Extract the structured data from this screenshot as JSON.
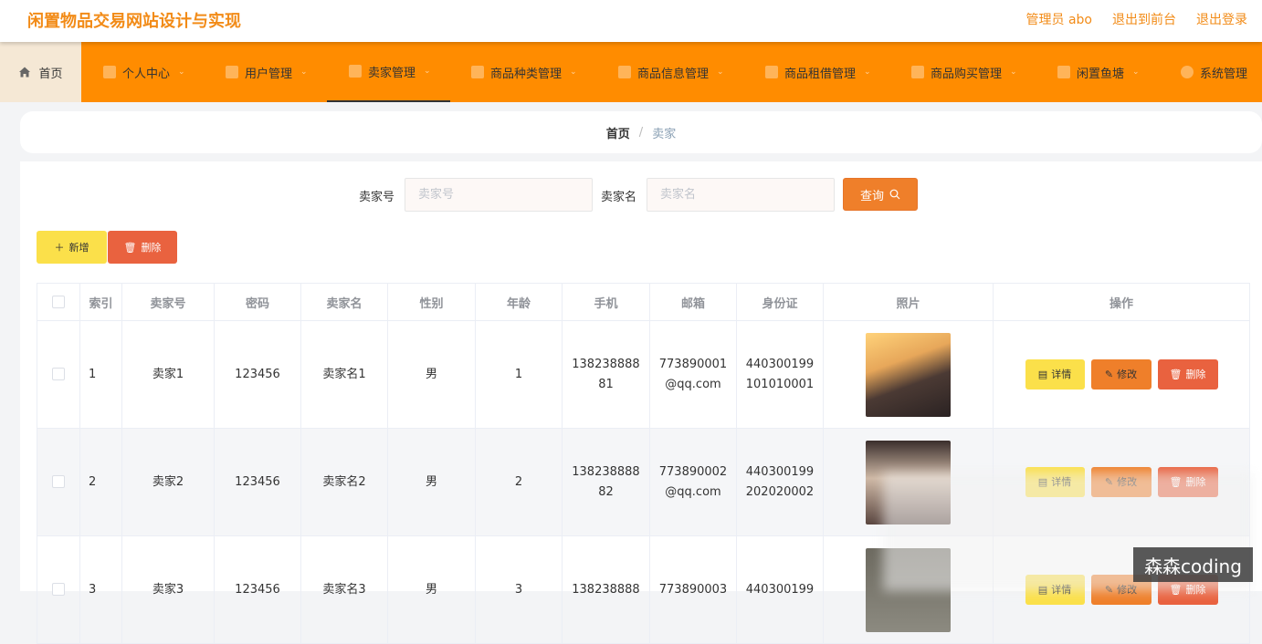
{
  "header": {
    "site_title": "闲置物品交易网站设计与实现",
    "admin_label": "管理员 abo",
    "front_link": "退出到前台",
    "logout_link": "退出登录"
  },
  "nav": {
    "home": "首页",
    "items": [
      {
        "label": "个人中心",
        "icon": "user-icon"
      },
      {
        "label": "用户管理",
        "icon": "list-icon"
      },
      {
        "label": "卖家管理",
        "icon": "menu-icon"
      },
      {
        "label": "商品种类管理",
        "icon": "user-icon"
      },
      {
        "label": "商品信息管理",
        "icon": "monitor-icon"
      },
      {
        "label": "商品租借管理",
        "icon": "clipboard-icon"
      },
      {
        "label": "商品购买管理",
        "icon": "copy-icon"
      },
      {
        "label": "闲置鱼塘",
        "icon": "message-icon"
      },
      {
        "label": "系统管理",
        "icon": "gear-icon"
      }
    ]
  },
  "breadcrumb": {
    "home": "首页",
    "separator": "/",
    "current": "卖家"
  },
  "search": {
    "field1_label": "卖家号",
    "field1_placeholder": "卖家号",
    "field2_label": "卖家名",
    "field2_placeholder": "卖家名",
    "query_label": "查询"
  },
  "actions": {
    "add_label": "新增",
    "delete_label": "删除"
  },
  "table": {
    "headers": [
      "索引",
      "卖家号",
      "密码",
      "卖家名",
      "性别",
      "年龄",
      "手机",
      "邮箱",
      "身份证",
      "照片",
      "操作"
    ],
    "rows": [
      {
        "index": "1",
        "seller_no": "卖家1",
        "password": "123456",
        "seller_name": "卖家名1",
        "gender": "男",
        "age": "1",
        "phone_a": "138238888",
        "phone_b": "81",
        "email_a": "773890001",
        "email_b": "@qq.com",
        "id_a": "440300199",
        "id_b": "101010001"
      },
      {
        "index": "2",
        "seller_no": "卖家2",
        "password": "123456",
        "seller_name": "卖家名2",
        "gender": "男",
        "age": "2",
        "phone_a": "138238888",
        "phone_b": "82",
        "email_a": "773890002",
        "email_b": "@qq.com",
        "id_a": "440300199",
        "id_b": "202020002"
      },
      {
        "index": "3",
        "seller_no": "卖家3",
        "password": "123456",
        "seller_name": "卖家名3",
        "gender": "男",
        "age": "3",
        "phone_a": "138238888",
        "phone_b": "",
        "email_a": "773890003",
        "email_b": "",
        "id_a": "440300199",
        "id_b": ""
      }
    ],
    "op_detail": "详情",
    "op_edit": "修改",
    "op_delete": "删除"
  },
  "watermark": "森森coding",
  "colors": {
    "accent": "#ff8c00",
    "title": "#f28b17",
    "add": "#fbe04a",
    "danger": "#e9623f",
    "query": "#ef7f2a"
  }
}
